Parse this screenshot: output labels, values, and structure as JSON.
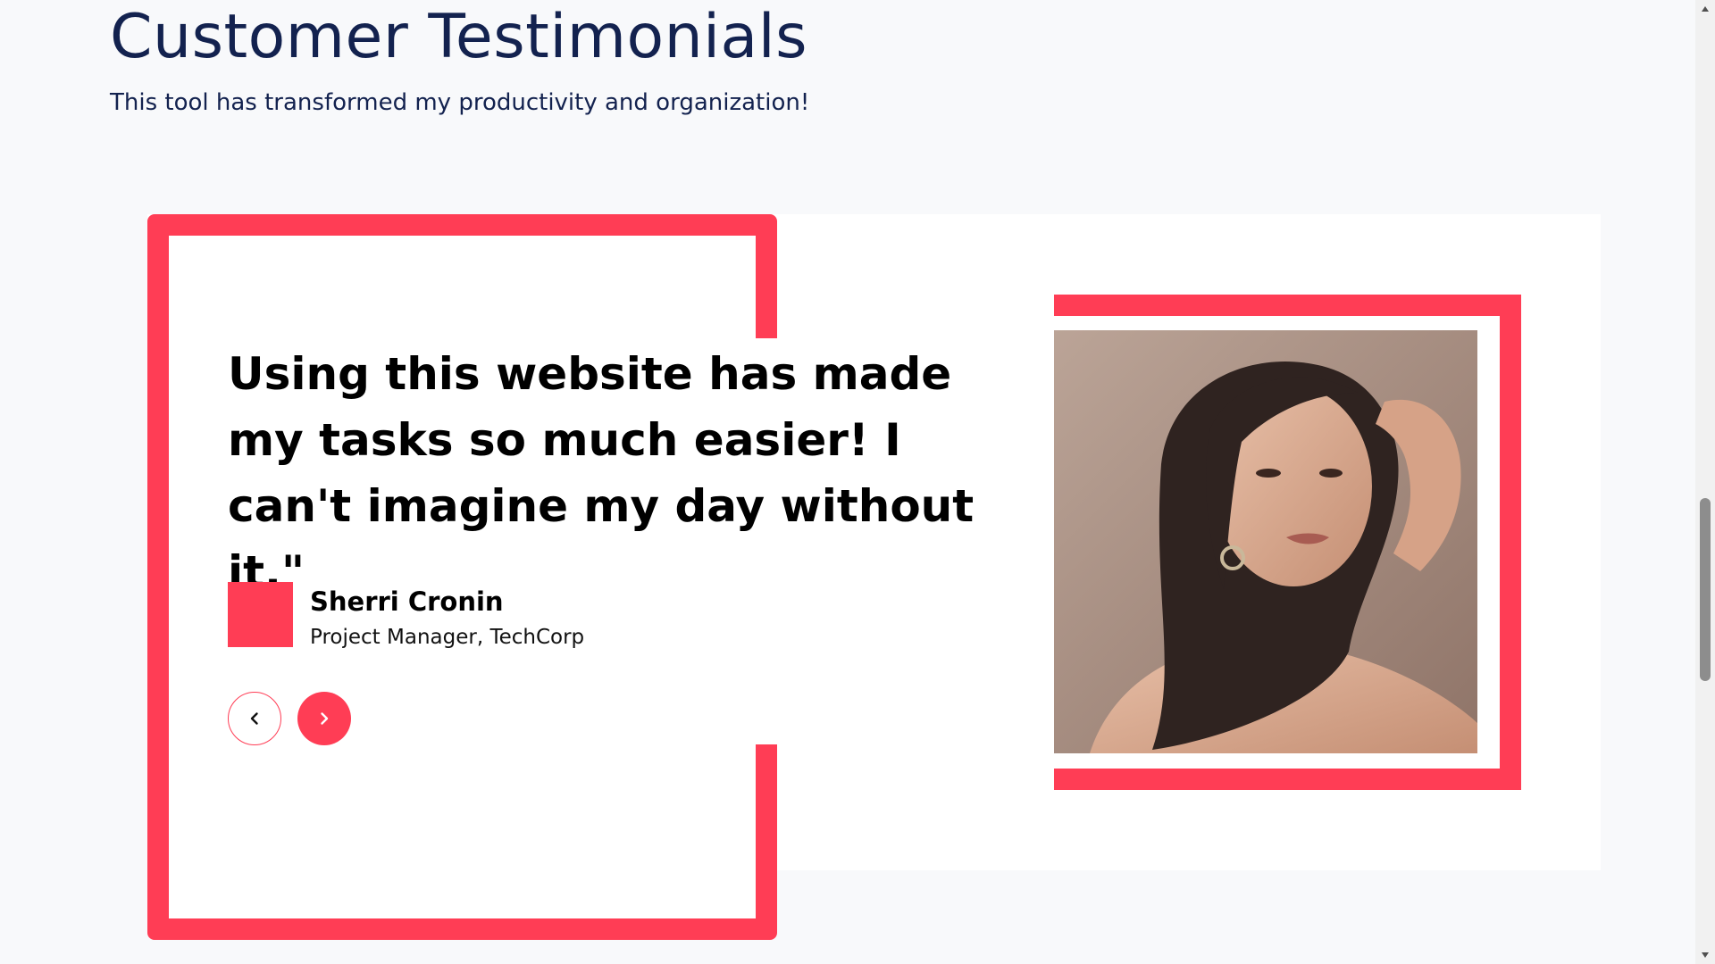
{
  "header": {
    "title": "Customer Testimonials",
    "subtitle": "This tool has transformed my productivity and organization!"
  },
  "testimonial": {
    "quote": "Using this website has made my tasks so much easier! I can't imagine my day without it.\"",
    "author_name": "Sherri Cronin",
    "author_role": "Project Manager, TechCorp",
    "photo_alt": "Portrait of Sherri Cronin"
  },
  "navigation": {
    "prev_icon": "chevron-left-icon",
    "next_icon": "chevron-right-icon"
  },
  "colors": {
    "accent": "#ff3d55",
    "heading": "#13224f",
    "background": "#f8f9fb",
    "card": "#ffffff"
  }
}
